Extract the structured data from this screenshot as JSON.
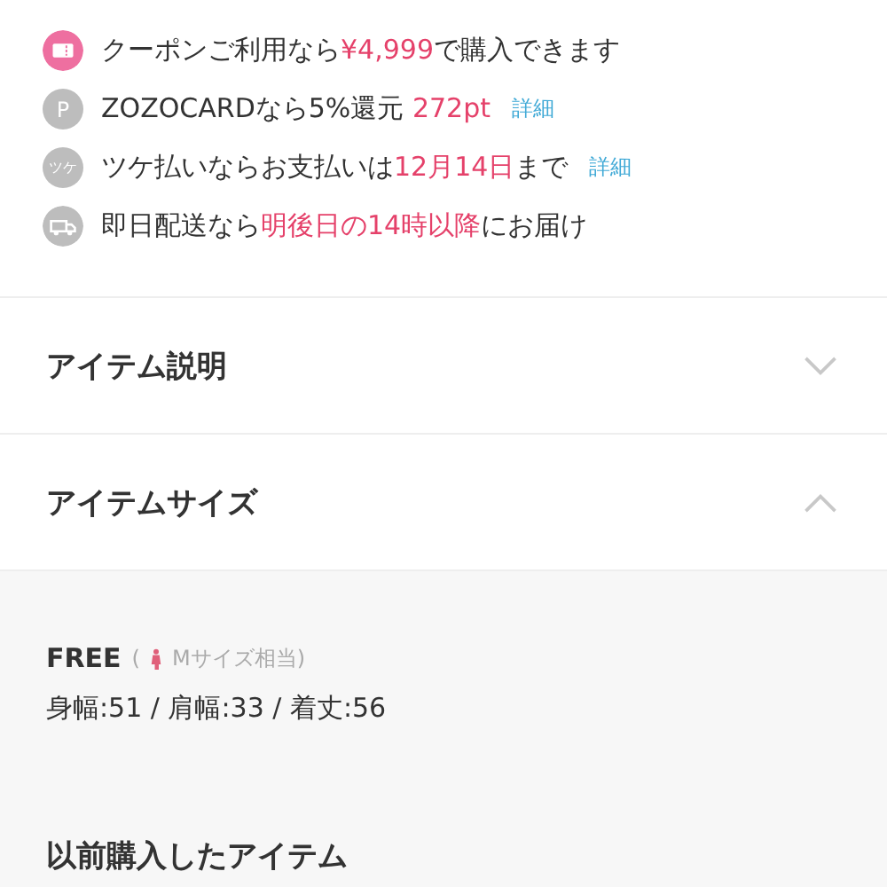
{
  "benefits": [
    {
      "icon": {
        "kind": "coupon",
        "color": "#ee6fa0"
      },
      "parts": [
        {
          "text": "クーポンご利用なら",
          "kind": "plain"
        },
        {
          "text": "¥4,999",
          "kind": "accent"
        },
        {
          "text": "で購入できます",
          "kind": "plain"
        }
      ]
    },
    {
      "icon": {
        "kind": "letter",
        "text": "P",
        "color": "#bdbdbd"
      },
      "parts": [
        {
          "text": "ZOZOCARDなら5%還元 ",
          "kind": "plain"
        },
        {
          "text": "272pt",
          "kind": "accent"
        }
      ],
      "link": "詳細"
    },
    {
      "icon": {
        "kind": "letter",
        "text": "ツケ",
        "color": "#bdbdbd"
      },
      "parts": [
        {
          "text": "ツケ払いならお支払いは",
          "kind": "plain"
        },
        {
          "text": "12月14日",
          "kind": "accent"
        },
        {
          "text": "まで",
          "kind": "plain"
        }
      ],
      "link": "詳細"
    },
    {
      "icon": {
        "kind": "truck",
        "color": "#bdbdbd"
      },
      "parts": [
        {
          "text": "即日配送なら",
          "kind": "plain"
        },
        {
          "text": "明後日の14時以降",
          "kind": "accent"
        },
        {
          "text": "にお届け",
          "kind": "plain"
        }
      ]
    }
  ],
  "accordions": [
    {
      "title": "アイテム説明",
      "expanded": false
    },
    {
      "title": "アイテムサイズ",
      "expanded": true
    }
  ],
  "size": {
    "label": "FREE",
    "note_open": "(",
    "note": "Mサイズ相当)",
    "measurements": "身幅:51 / 肩幅:33 / 着丈:56"
  },
  "previous_section": {
    "title": "以前購入したアイテム"
  }
}
